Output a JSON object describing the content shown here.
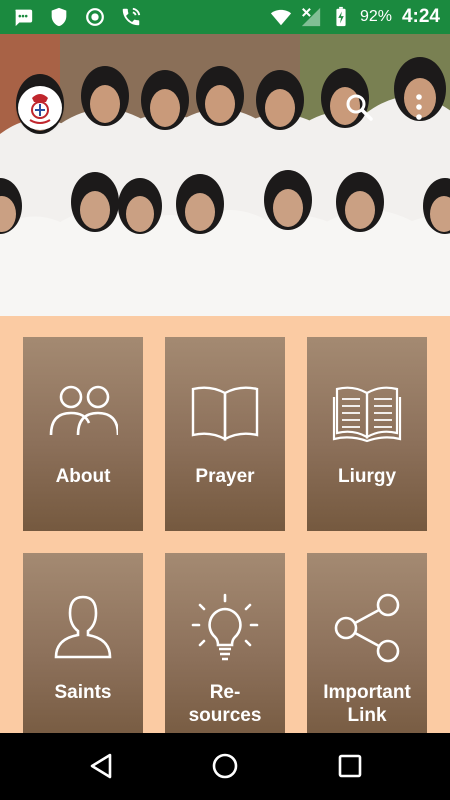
{
  "status_bar": {
    "battery_percent": "92%",
    "time": "4:24",
    "icons": [
      "chat-icon",
      "shield-icon",
      "record-icon",
      "phone-wifi-icon",
      "wifi-icon",
      "no-signal-icon",
      "battery-charging-icon"
    ]
  },
  "header": {
    "logo": "congregation-emblem-logo",
    "actions": [
      "search-icon",
      "more-vert-icon"
    ]
  },
  "menu": {
    "tiles": [
      {
        "label": "About",
        "icon": "people-icon"
      },
      {
        "label": "Prayer",
        "icon": "open-book-icon"
      },
      {
        "label": "Liurgy",
        "icon": "text-book-icon"
      },
      {
        "label": "Saints",
        "icon": "person-icon"
      },
      {
        "label": "Re-\nsources",
        "icon": "lightbulb-icon"
      },
      {
        "label": "Important\nLink",
        "icon": "share-icon"
      }
    ]
  },
  "navigation": {
    "buttons": [
      "back-icon",
      "home-icon",
      "recents-icon"
    ]
  },
  "colors": {
    "status_bar": "#1b8a3f",
    "background": "#fbcba3",
    "tile_top": "#a48a72",
    "tile_bottom": "#75593f"
  }
}
